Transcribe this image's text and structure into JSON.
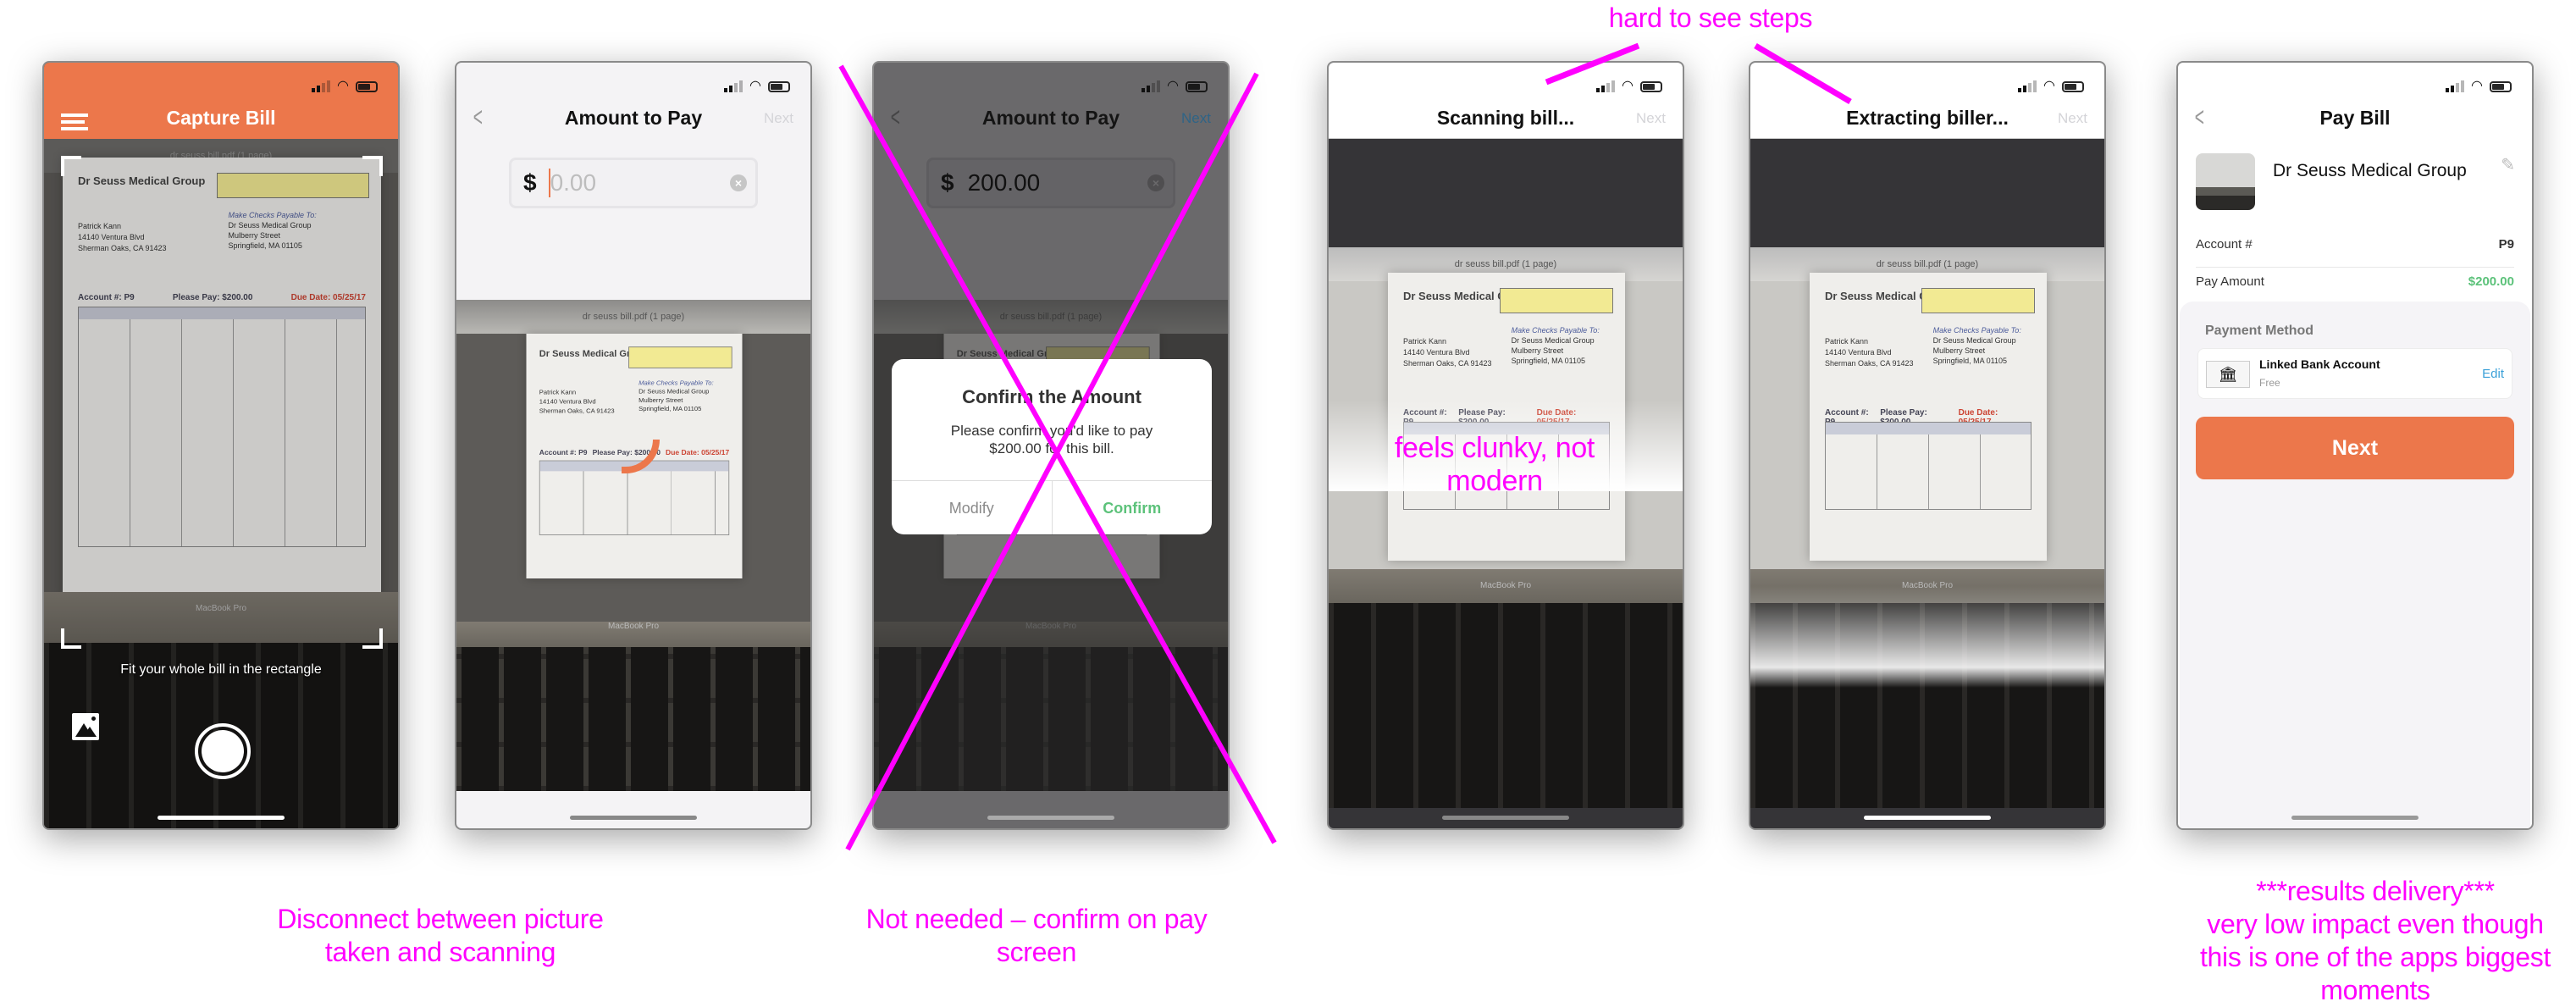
{
  "colors": {
    "accent": "#ec774b",
    "annotation": "#ff00ff",
    "amount_green": "#5cc27a",
    "link_blue": "#3aa0d8"
  },
  "bill": {
    "pdf_title": "dr seuss bill.pdf (1 page)",
    "provider": "Dr Seuss Medical Group",
    "patient": [
      "Patrick Kann",
      "14140 Ventura Blvd",
      "Sherman Oaks, CA 91423"
    ],
    "payable_label": "Make Checks Payable To:",
    "payable": [
      "Dr Seuss Medical Group",
      "Mulberry Street",
      "Springfield, MA 01105"
    ],
    "account": "Account #: P9",
    "please_pay": "Please Pay: $200.00",
    "due_date": "Due Date: 05/25/17",
    "laptop": "MacBook Pro"
  },
  "screens": {
    "capture": {
      "title": "Capture Bill",
      "hint": "Fit your whole bill in the rectangle",
      "menu_icon": "hamburger-icon",
      "gallery_icon": "photo-gallery-icon"
    },
    "amount": {
      "title": "Amount to Pay",
      "next": "Next",
      "currency": "$",
      "placeholder": "0.00"
    },
    "confirm": {
      "title": "Amount to Pay",
      "next": "Next",
      "currency": "$",
      "value": "200.00",
      "dialog": {
        "title": "Confirm the Amount",
        "message": "Please confirm you'd like to pay $200.00 for this bill.",
        "modify": "Modify",
        "confirm": "Confirm"
      }
    },
    "scanning": {
      "title": "Scanning bill...",
      "next": "Next"
    },
    "extracting": {
      "title": "Extracting biller...",
      "next": "Next"
    },
    "pay": {
      "title": "Pay Bill",
      "biller": "Dr Seuss Medical Group",
      "account_label": "Account #",
      "account_value": "P9",
      "amount_label": "Pay Amount",
      "amount_value": "$200.00",
      "method_header": "Payment Method",
      "method_name": "Linked Bank Account",
      "method_fee": "Free",
      "edit": "Edit",
      "next": "Next"
    }
  },
  "annotations": {
    "steps": "hard to see steps",
    "clunky": "feels clunky, not modern",
    "disconnect": [
      "Disconnect between picture",
      "taken and scanning"
    ],
    "not_needed": [
      "Not needed – confirm on pay",
      "screen"
    ],
    "results": [
      "***results delivery***",
      "very low impact even though",
      "this is one of the apps biggest",
      "moments"
    ]
  }
}
